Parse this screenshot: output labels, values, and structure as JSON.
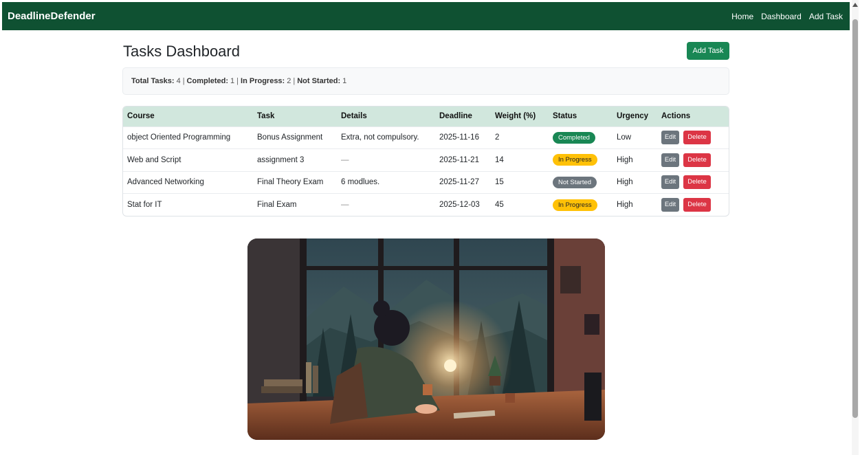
{
  "navbar": {
    "brand": "DeadlineDefender",
    "links": [
      "Home",
      "Dashboard",
      "Add Task"
    ]
  },
  "page": {
    "title": "Tasks Dashboard",
    "add_button": "Add Task"
  },
  "summary": {
    "total_label": "Total Tasks:",
    "total_value": "4",
    "completed_label": "Completed:",
    "completed_value": "1",
    "in_progress_label": "In Progress:",
    "in_progress_value": "2",
    "not_started_label": "Not Started:",
    "not_started_value": "1",
    "separator": "|"
  },
  "table": {
    "headers": [
      "Course",
      "Task",
      "Details",
      "Deadline",
      "Weight (%)",
      "Status",
      "Urgency",
      "Actions"
    ],
    "edit_label": "Edit",
    "delete_label": "Delete",
    "rows": [
      {
        "course": "object Oriented Programming",
        "task": "Bonus Assignment",
        "details": "Extra, not compulsory.",
        "deadline": "2025-11-16",
        "weight": "2",
        "status": "Completed",
        "urgency": "Low"
      },
      {
        "course": "Web and Script",
        "task": "assignment 3",
        "details": "—",
        "deadline": "2025-11-21",
        "weight": "14",
        "status": "In Progress",
        "urgency": "High"
      },
      {
        "course": "Advanced Networking",
        "task": "Final Theory Exam",
        "details": "6 modlues.",
        "deadline": "2025-11-27",
        "weight": "15",
        "status": "Not Started",
        "urgency": "High"
      },
      {
        "course": "Stat for IT",
        "task": "Final Exam",
        "details": "—",
        "deadline": "2025-12-03",
        "weight": "45",
        "status": "In Progress",
        "urgency": "High"
      }
    ]
  },
  "colors": {
    "navbar": "#0f5132",
    "primary_button": "#198754",
    "table_header": "#d1e7dd",
    "badge_completed": "#198754",
    "badge_in_progress": "#ffc107",
    "badge_not_started": "#6c757d",
    "edit_button": "#6c757d",
    "delete_button": "#dc3545"
  }
}
